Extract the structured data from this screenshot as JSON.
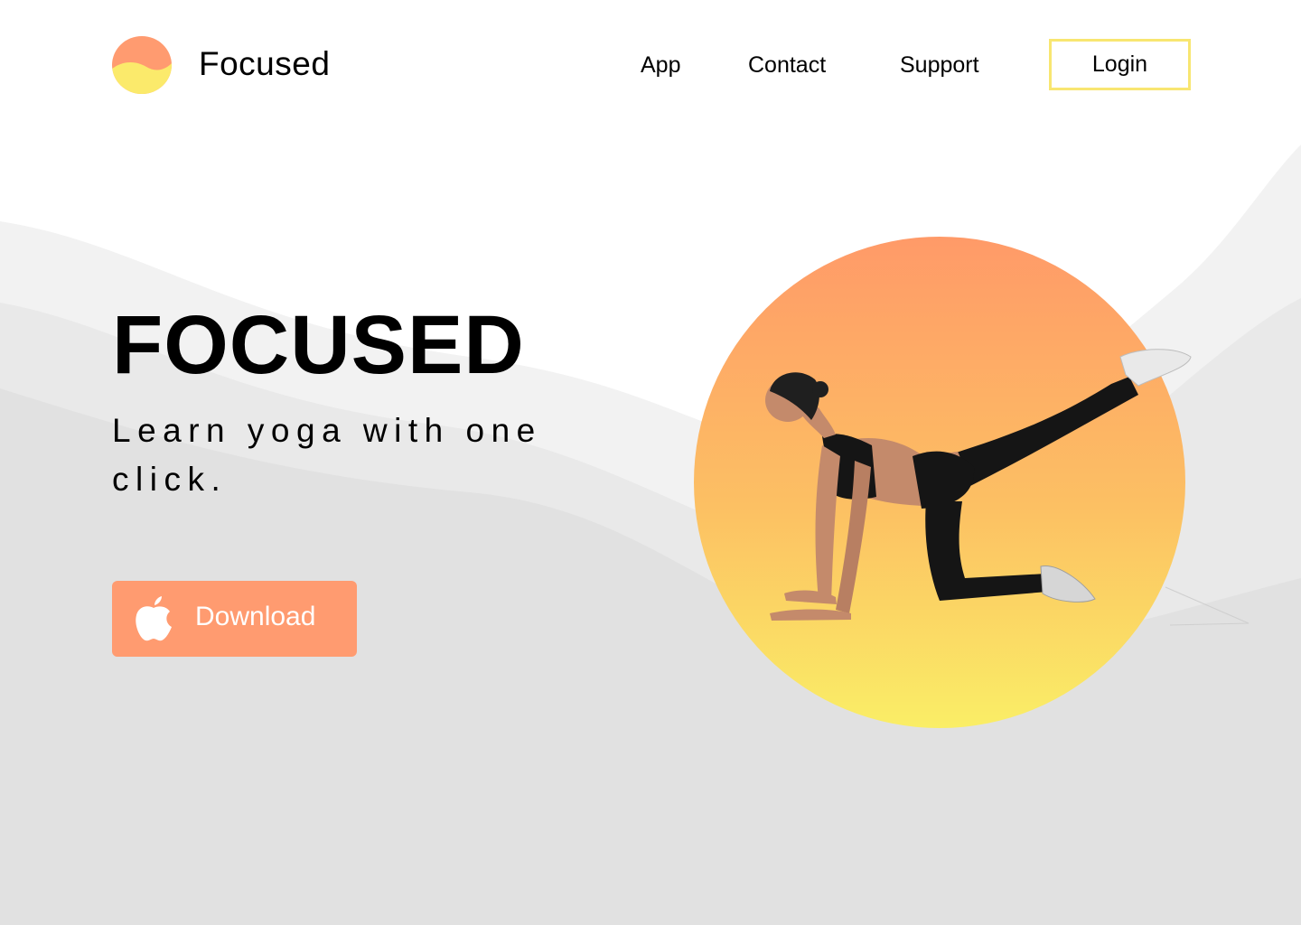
{
  "header": {
    "brand": "Focused",
    "nav": [
      {
        "label": "App"
      },
      {
        "label": "Contact"
      },
      {
        "label": "Support"
      }
    ],
    "login_label": "Login"
  },
  "hero": {
    "title": "FOCUSED",
    "subtitle": "Learn yoga with one click.",
    "download_label": "Download",
    "download_icon": "apple-icon",
    "image": "yoga-pose-illustration"
  },
  "colors": {
    "accent_orange": "#ff9b70",
    "accent_yellow": "#f8e671",
    "wave_light": "#f2f2f2",
    "wave_mid": "#e8e8e8",
    "wave_dark": "#e0e0e0"
  }
}
